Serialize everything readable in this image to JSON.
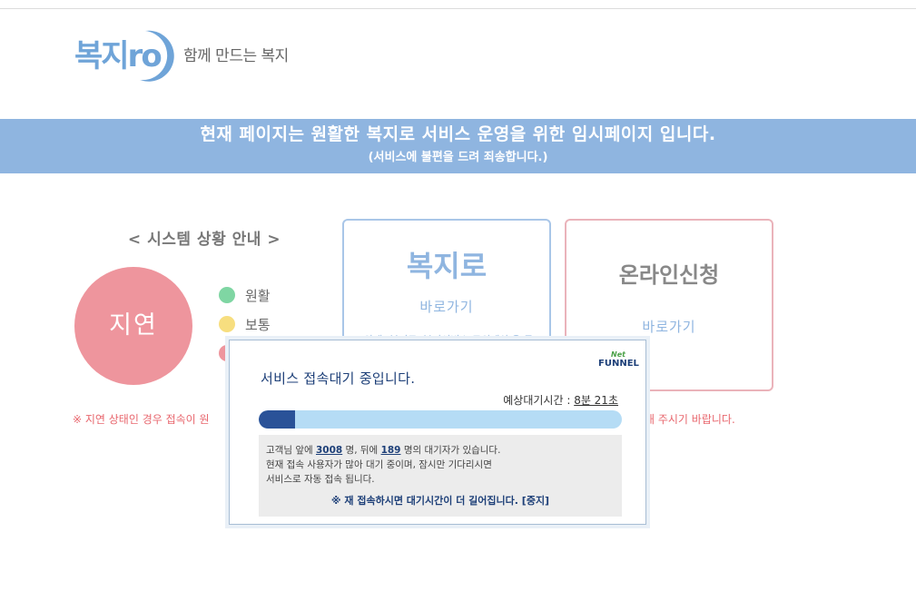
{
  "logo": {
    "mark_text": "복지ro",
    "slogan": "함께 만드는 복지"
  },
  "banner": {
    "title": "현재 페이지는 원활한 복지로 서비스 운영을 위한 임시페이지 입니다.",
    "subtitle": "(서비스에 불편을 드려 죄송합니다.)"
  },
  "status": {
    "title": "< 시스템 상황 안내 >",
    "current": "지연",
    "current_color": "#ee959d",
    "legend": [
      {
        "label": "원활",
        "color": "#7fd6a3"
      },
      {
        "label": "보통",
        "color": "#f7de7f"
      },
      {
        "label": "",
        "color": "#ee959d"
      }
    ]
  },
  "notice": {
    "left": "※ 지연 상태인 경우 접속이 원",
    "right": "해 주시기 바랍니다."
  },
  "cards": {
    "bokjiro": {
      "title": "복지로",
      "link": "바로가기",
      "desc": "(안내) 복지로 '복지서비스 모의계산'은 구"
    },
    "online": {
      "title": "온라인신청",
      "link": "바로가기"
    }
  },
  "popup": {
    "brand_top": "Net",
    "brand_bottom": "FUNNEL",
    "title": "서비스 접속대기 중입니다.",
    "wait_label": "예상대기시간 : ",
    "wait_value": "8분 21초",
    "progress_percent": 10,
    "line1_a": "고객님 앞에 ",
    "ahead_count": "3008",
    "line1_b": " 명, 뒤에 ",
    "behind_count": "189",
    "line1_c": " 명의 대기자가 있습니다.",
    "line2": "현재 접속 사용자가 많아 대기 중이며, 잠시만 기다리시면",
    "line3": "서비스로 자동 접속 됩니다.",
    "warning": "※ 재 접속하시면 대기시간이 더 길어집니다. [중지]"
  }
}
